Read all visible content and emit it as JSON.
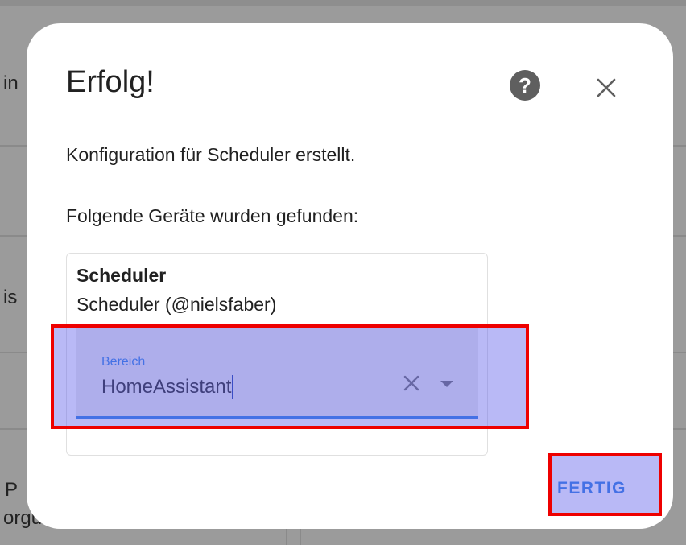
{
  "background": {
    "fragments": [
      "in",
      "is",
      "P",
      "orgungsprüfer"
    ]
  },
  "dialog": {
    "title": "Erfolg!",
    "help_icon": "help-circle-icon",
    "close_icon": "close-icon",
    "message": "Konfiguration für Scheduler erstellt.",
    "devices_heading": "Folgende Geräte wurden gefunden:",
    "device": {
      "name": "Scheduler",
      "model": "Scheduler (@nielsfaber)",
      "area": {
        "label": "Bereich",
        "value": "HomeAssistant",
        "clear_icon": "clear-icon",
        "dropdown_icon": "dropdown-arrow-icon"
      }
    },
    "done_button": "FERTIG"
  },
  "colors": {
    "accent": "#2a7de1",
    "highlight_border": "#ee0000",
    "highlight_fill": "#6464eb"
  }
}
